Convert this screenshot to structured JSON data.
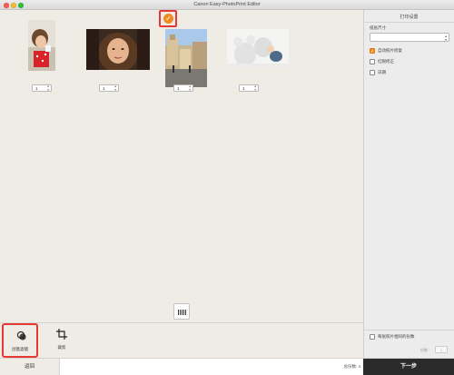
{
  "window": {
    "title": "Canon Easy-PhotoPrint Editor"
  },
  "photos": [
    {
      "name": "girl-with-cup",
      "copies": "1"
    },
    {
      "name": "woman-portrait",
      "copies": "1"
    },
    {
      "name": "european-square",
      "copies": "1"
    },
    {
      "name": "baby-with-teddy",
      "copies": "1"
    }
  ],
  "toolbar": {
    "creative_filter_label": "创意滤镜",
    "crop_label": "裁剪"
  },
  "footer": {
    "back_label": "返回",
    "total_copies": "总份数: 4",
    "next_label": "下一步"
  },
  "panel": {
    "title": "打印设置",
    "paper_size_label": "纸张尺寸",
    "paper_size_value": "",
    "options": [
      {
        "label": "自动照片修复",
        "checked": true
      },
      {
        "label": "红眼修正",
        "checked": false
      },
      {
        "label": "日期",
        "checked": false
      }
    ],
    "same_copies_label": "每张照片相同的份数",
    "copies_label": "份数",
    "copies_value": "1"
  },
  "icons": [
    "check-icon",
    "grid-view-icon",
    "filter-icon",
    "crop-icon"
  ],
  "colors": {
    "accent_orange": "#f08a22",
    "highlight_red": "#e53935",
    "next_button": "#2b2b2b"
  }
}
